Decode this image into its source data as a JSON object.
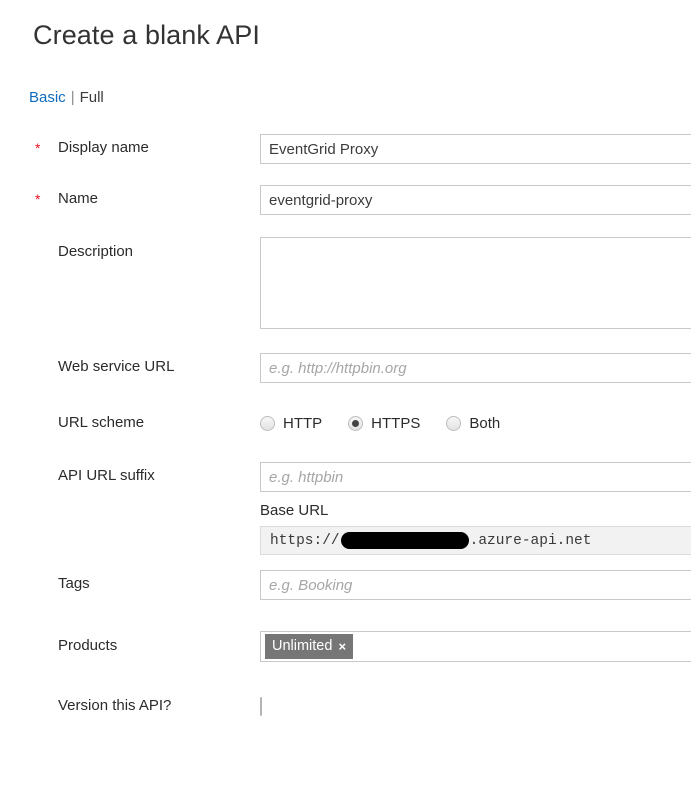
{
  "page": {
    "title": "Create a blank API"
  },
  "view_switch": {
    "basic_label": "Basic",
    "separator": "|",
    "full_label": "Full",
    "active": "Basic",
    "active_color": "#0f6cbd"
  },
  "form": {
    "display_name": {
      "label": "Display name",
      "required_marker": "*",
      "value": "EventGrid Proxy",
      "placeholder": ""
    },
    "name": {
      "label": "Name",
      "required_marker": "*",
      "value": "eventgrid-proxy",
      "placeholder": ""
    },
    "description": {
      "label": "Description",
      "value": "",
      "placeholder": ""
    },
    "web_service_url": {
      "label": "Web service URL",
      "value": "",
      "placeholder": "e.g. http://httpbin.org"
    },
    "url_scheme": {
      "label": "URL scheme",
      "selected": "HTTPS",
      "options": [
        {
          "label": "HTTP",
          "checked": false
        },
        {
          "label": "HTTPS",
          "checked": true
        },
        {
          "label": "Both",
          "checked": false
        }
      ]
    },
    "api_url_suffix": {
      "label": "API URL suffix",
      "value": "",
      "placeholder": "e.g. httpbin"
    },
    "base_url": {
      "label": "Base URL",
      "prefix": "https://",
      "redacted": true,
      "suffix": ".azure-api.net"
    },
    "tags": {
      "label": "Tags",
      "value": "",
      "placeholder": "e.g. Booking"
    },
    "products": {
      "label": "Products",
      "chips": [
        {
          "label": "Unlimited",
          "remove": "×"
        }
      ],
      "chip_bg": "#767676"
    },
    "version_this_api": {
      "label": "Version this API?",
      "checked": false
    }
  }
}
